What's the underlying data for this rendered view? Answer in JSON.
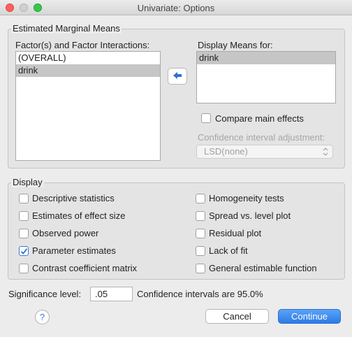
{
  "window": {
    "title": "Univariate: Options"
  },
  "emm": {
    "legend": "Estimated Marginal Means",
    "factors_label": "Factor(s) and Factor Interactions:",
    "factors": [
      "(OVERALL)",
      "drink"
    ],
    "display_means_label": "Display Means for:",
    "display_means": [
      "drink"
    ],
    "compare_main_effects": "Compare main effects",
    "ci_adjustment_label": "Confidence interval adjustment:",
    "ci_adjustment_value": "LSD(none)"
  },
  "display": {
    "legend": "Display",
    "options_left": [
      {
        "label": "Descriptive statistics",
        "checked": false
      },
      {
        "label": "Estimates of effect size",
        "checked": false
      },
      {
        "label": "Observed power",
        "checked": false
      },
      {
        "label": "Parameter estimates",
        "checked": true
      },
      {
        "label": "Contrast coefficient matrix",
        "checked": false
      }
    ],
    "options_right": [
      {
        "label": "Homogeneity tests",
        "checked": false
      },
      {
        "label": "Spread vs. level plot",
        "checked": false
      },
      {
        "label": "Residual plot",
        "checked": false
      },
      {
        "label": "Lack of fit",
        "checked": false
      },
      {
        "label": "General estimable function",
        "checked": false
      }
    ]
  },
  "footer": {
    "significance_label": "Significance level:",
    "significance_value": ".05",
    "ci_text": "Confidence intervals are 95.0%",
    "help": "?",
    "cancel": "Cancel",
    "continue": "Continue"
  },
  "colors": {
    "accent": "#2c7be6",
    "selection": "#c6c6c6"
  }
}
